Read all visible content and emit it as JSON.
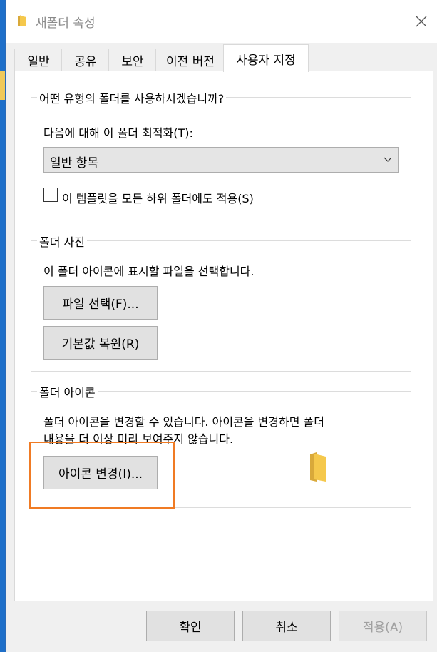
{
  "window": {
    "title": "새폴더 속성"
  },
  "tabs": [
    {
      "label": "일반"
    },
    {
      "label": "공유"
    },
    {
      "label": "보안"
    },
    {
      "label": "이전 버전"
    },
    {
      "label": "사용자 지정"
    }
  ],
  "optimize": {
    "group_title": "어떤 유형의 폴더를 사용하시겠습니까?",
    "label": "다음에 대해 이 폴더 최적화(T):",
    "selected": "일반 항목",
    "checkbox_label": "이 템플릿을 모든 하위 폴더에도 적용(S)",
    "checked": false
  },
  "pictures": {
    "group_title": "폴더 사진",
    "description": "이 폴더 아이콘에 표시할 파일을 선택합니다.",
    "choose_file": "파일 선택(F)...",
    "restore_default": "기본값 복원(R)"
  },
  "icons": {
    "group_title": "폴더 아이콘",
    "description_line1": "폴더 아이콘을 변경할 수 있습니다. 아이콘을 변경하면 폴더",
    "description_line2": "내용을 더 이상 미리 보여주지 않습니다.",
    "change_icon": "아이콘 변경(I)..."
  },
  "footer": {
    "ok": "확인",
    "cancel": "취소",
    "apply": "적용(A)"
  },
  "colors": {
    "accent_highlight": "#f07b24",
    "folder": "#f5c84c"
  }
}
